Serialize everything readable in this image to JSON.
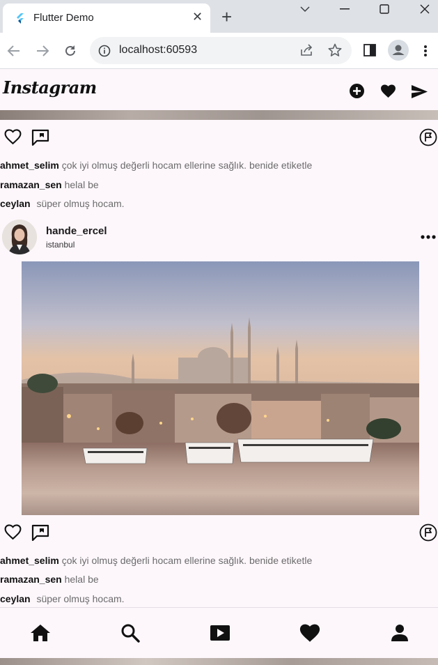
{
  "browser": {
    "tab_title": "Flutter Demo",
    "url": "localhost:60593"
  },
  "app": {
    "logo": "Instagram"
  },
  "top_post": {
    "comments": [
      {
        "user": "ahmet_selim",
        "text": "çok iyi olmuş değerli hocam ellerine sağlık. benide etiketle"
      },
      {
        "user": "ramazan_sen",
        "text": "helal be"
      },
      {
        "user": "ceylan",
        "text": "süper olmuş hocam."
      }
    ]
  },
  "post": {
    "username": "hande_ercel",
    "location": "istanbul",
    "comments": [
      {
        "user": "ahmet_selim",
        "text": "çok iyi olmuş değerli hocam ellerine sağlık. benide etiketle"
      },
      {
        "user": "ramazan_sen",
        "text": "helal be"
      },
      {
        "user": "ceylan",
        "text": "süper olmuş hocam."
      }
    ]
  },
  "icons": {
    "appbar": [
      "add-circle-icon",
      "heart-icon",
      "send-icon"
    ],
    "post_actions": [
      "heart-outline-icon",
      "comment-icon",
      "report-icon"
    ],
    "bottom_nav": [
      "home-icon",
      "search-icon",
      "video-icon",
      "heart-icon",
      "person-icon"
    ]
  },
  "colors": {
    "background": "#fdf7fc",
    "text": "#111111"
  }
}
